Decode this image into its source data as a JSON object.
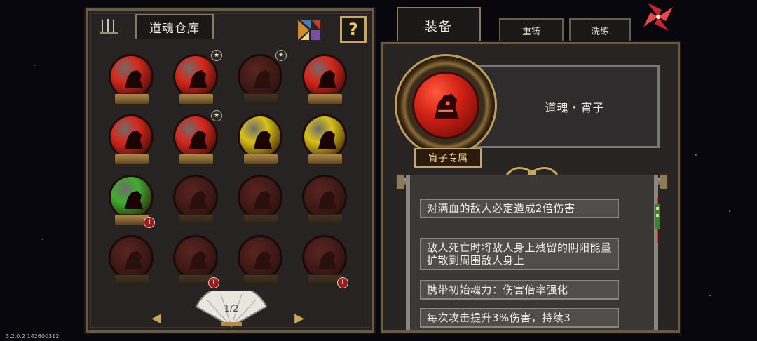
{
  "warehouse": {
    "title": "道魂仓库",
    "help_label": "?",
    "page_indicator": "1/2",
    "prev_label": "◀",
    "next_label": "▶",
    "slots": [
      {
        "color": "red",
        "active": true,
        "star": false,
        "alert": false
      },
      {
        "color": "red",
        "active": true,
        "star": true,
        "alert": false
      },
      {
        "color": "red",
        "active": false,
        "star": true,
        "alert": false
      },
      {
        "color": "red",
        "active": true,
        "star": false,
        "alert": false
      },
      {
        "color": "red",
        "active": true,
        "star": false,
        "alert": false
      },
      {
        "color": "red",
        "active": true,
        "star": true,
        "alert": false
      },
      {
        "color": "yellow",
        "active": true,
        "star": false,
        "alert": false
      },
      {
        "color": "yellow",
        "active": true,
        "star": false,
        "alert": false
      },
      {
        "color": "green",
        "active": true,
        "star": false,
        "alert": true
      },
      {
        "color": "red",
        "active": false,
        "star": false,
        "alert": false
      },
      {
        "color": "red",
        "active": false,
        "star": false,
        "alert": false
      },
      {
        "color": "red",
        "active": false,
        "star": false,
        "alert": false
      },
      {
        "color": "red",
        "active": false,
        "star": false,
        "alert": false
      },
      {
        "color": "red",
        "active": false,
        "star": false,
        "alert": true
      },
      {
        "color": "red",
        "active": false,
        "star": false,
        "alert": false
      },
      {
        "color": "red",
        "active": false,
        "star": false,
        "alert": true
      }
    ]
  },
  "tabs": {
    "equip": "装备",
    "recast": "重铸",
    "refine": "洗练"
  },
  "detail": {
    "soul_name": "道魂・宵子",
    "exclusive_tag": "宵子专属",
    "descriptions": [
      "对满血的敌人必定造成2倍伤害",
      "敌人死亡时将敌人身上残留的阴阳能量扩散到周围敌人身上",
      "携带初始魂力：伤害倍率强化",
      "每次攻击提升3%伤害，持续3"
    ]
  },
  "version": "3.2.0.2 142600312",
  "colors": {
    "red": "#d8281c",
    "yellow": "#d7c21a",
    "green": "#3fae2e",
    "gold": "#c9a85b"
  }
}
